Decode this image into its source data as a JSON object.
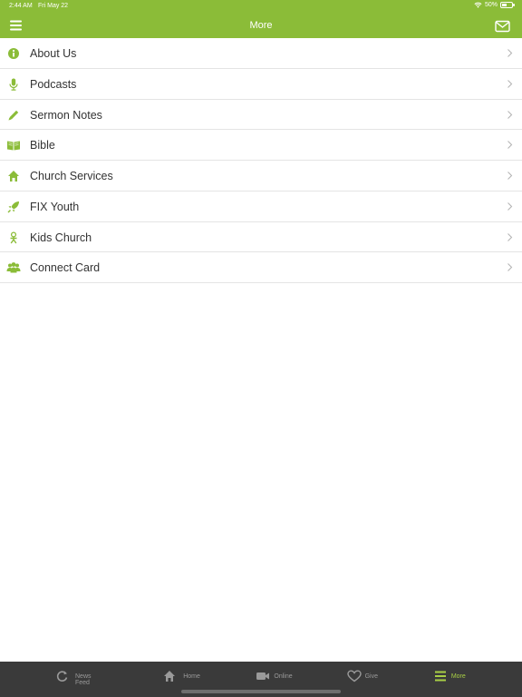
{
  "status": {
    "time": "2:44 AM",
    "date": "Fri May 22",
    "battery": "50%",
    "battery_level": 0.5,
    "icons": [
      "wifi-icon",
      "battery-icon"
    ]
  },
  "header": {
    "title": "More",
    "left_icon": "hamburger-menu-icon",
    "right_icon": "mail-icon"
  },
  "colors": {
    "accent": "#8bbc38",
    "tab_active": "#a8cf45",
    "tab_bar": "#3a3a3a"
  },
  "menu": {
    "items": [
      {
        "label": "About Us",
        "icon": "info-icon"
      },
      {
        "label": "Podcasts",
        "icon": "microphone-icon"
      },
      {
        "label": "Sermon Notes",
        "icon": "pencil-icon"
      },
      {
        "label": "Bible",
        "icon": "book-icon"
      },
      {
        "label": "Church Services",
        "icon": "home-icon"
      },
      {
        "label": "FIX Youth",
        "icon": "rocket-icon"
      },
      {
        "label": "Kids Church",
        "icon": "child-icon"
      },
      {
        "label": "Connect Card",
        "icon": "group-icon"
      }
    ]
  },
  "tabs": [
    {
      "label": "News Feed",
      "icon": "refresh-icon",
      "active": false
    },
    {
      "label": "Home",
      "icon": "home-icon",
      "active": false
    },
    {
      "label": "Online",
      "icon": "video-camera-icon",
      "active": false
    },
    {
      "label": "Give",
      "icon": "heart-icon",
      "active": false
    },
    {
      "label": "More",
      "icon": "list-icon",
      "active": true
    }
  ]
}
